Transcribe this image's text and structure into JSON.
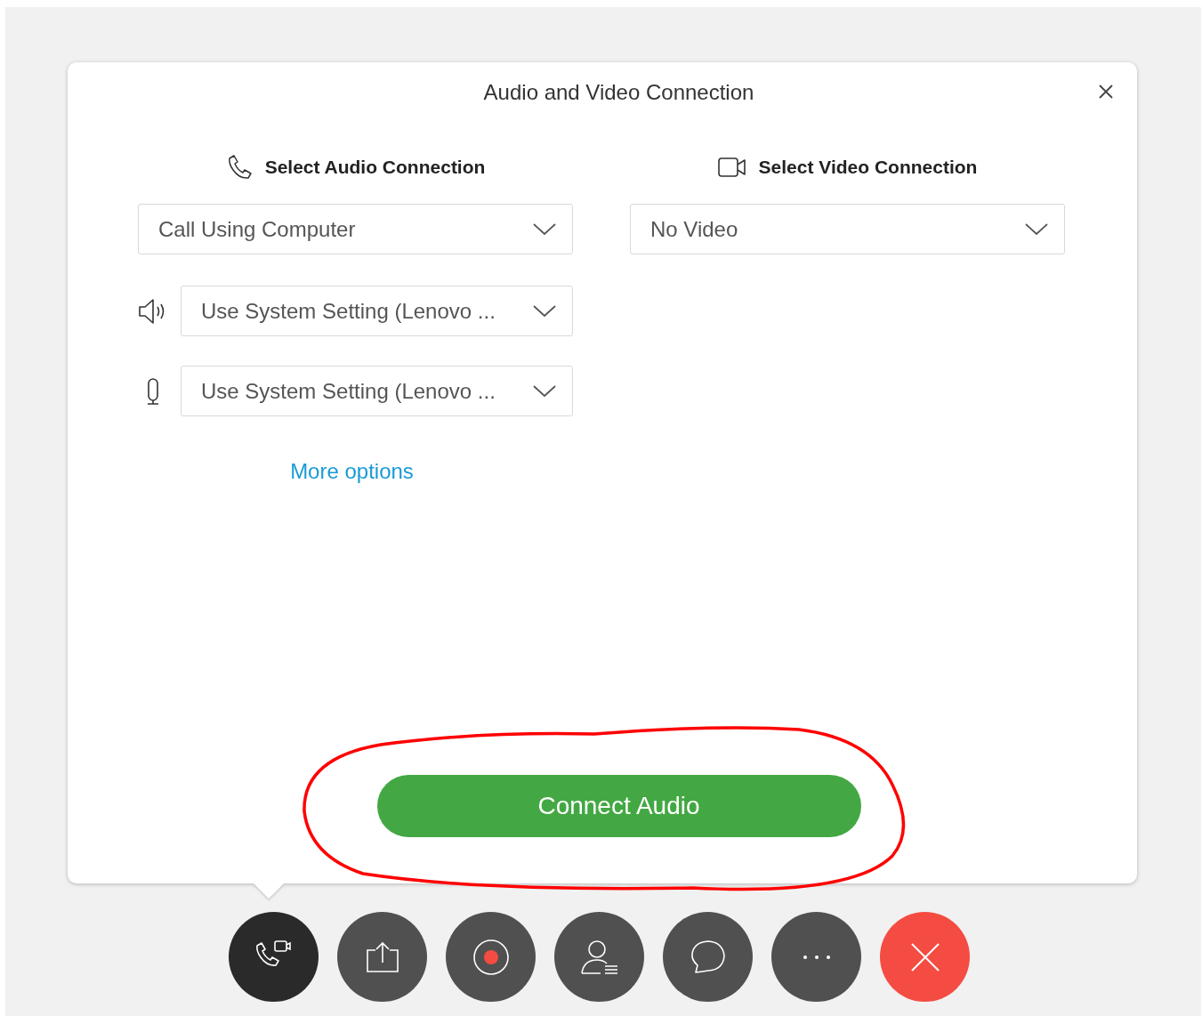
{
  "dialog": {
    "title": "Audio and Video Connection",
    "audio": {
      "heading": "Select Audio Connection",
      "connection": "Call Using Computer",
      "speaker": "Use System Setting (Lenovo ...",
      "microphone": "Use System Setting (Lenovo ...",
      "more_options": "More options"
    },
    "video": {
      "heading": "Select Video Connection",
      "connection": "No Video"
    },
    "connect_button": "Connect Audio"
  },
  "toolbar": [
    {
      "kind": "audio-video",
      "selected": true
    },
    {
      "kind": "share",
      "selected": false
    },
    {
      "kind": "record",
      "selected": false
    },
    {
      "kind": "participants",
      "selected": false
    },
    {
      "kind": "chat",
      "selected": false
    },
    {
      "kind": "more",
      "selected": false
    },
    {
      "kind": "end",
      "selected": false
    }
  ]
}
